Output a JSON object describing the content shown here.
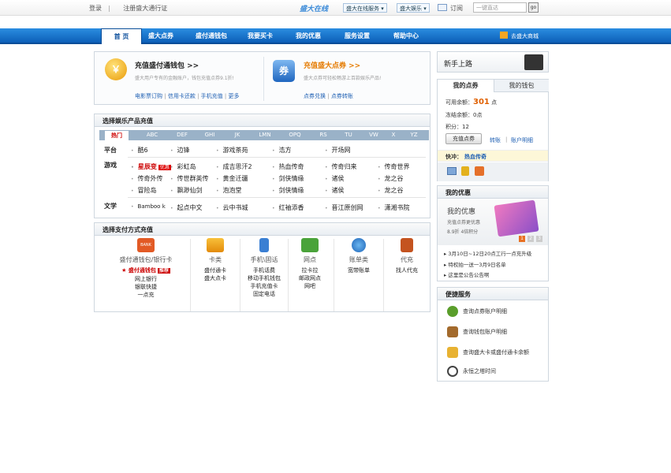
{
  "topbar": {
    "login": "登录",
    "register": "注册盛大通行证",
    "logo": "盛大在线",
    "services": "盛大在线服务 ▾",
    "ent": "盛大娱乐 ▾",
    "subscribe": "订阅",
    "search_placeholder": "一键直达",
    "go": "go"
  },
  "nav": {
    "items": [
      "首 页",
      "盛大点券",
      "盛付通钱包",
      "我要买卡",
      "我的优惠",
      "服务设置",
      "帮助中心"
    ],
    "mall": "去盛大商城"
  },
  "wallet": {
    "icon": "￥",
    "title": "充值盛付通钱包 >>",
    "desc": "盛大用户专有的金融账户，钱包充值点券9.1折!",
    "links": [
      "电影票订购",
      "信用卡还款",
      "手机充值",
      "更多"
    ]
  },
  "coupon": {
    "icon": "券",
    "title": "充值盛大点券 >>",
    "desc": "盛大点券可轻松畅游上百款娱乐产品!",
    "links": [
      "点券兑换",
      "点券转账"
    ]
  },
  "ent": {
    "title": "选择娱乐产品充值",
    "tabs": [
      "热门",
      "ABC",
      "DEF",
      "GHI",
      "JK",
      "LMN",
      "OPQ",
      "RS",
      "TU",
      "VW",
      "X",
      "YZ"
    ],
    "platform_label": "平台",
    "platform": [
      "酷6",
      "边锋",
      "游戏茶苑",
      "浩方",
      "开场网"
    ],
    "game_label": "游戏",
    "hot": "星辰变",
    "hot_badge": "优惠",
    "games": [
      "彩虹岛",
      "成吉思汗2",
      "热血传奇",
      "传奇归来",
      "传奇世界",
      "传奇外传",
      "传世群英传",
      "黄金迁疆",
      "剑侠情缘",
      "诸侯",
      "龙之谷",
      "冒险岛",
      "飘渺仙剑",
      "泡泡堂",
      "剑侠情缘",
      "诸侯",
      "龙之谷"
    ],
    "lit_label": "文学",
    "lit": [
      "Bamboo k",
      "起点中文",
      "云中书城",
      "红袖添香",
      "晋江原创网",
      "潇湘书院"
    ]
  },
  "pay": {
    "title": "选择支付方式充值",
    "cols": [
      {
        "title": "盛付通钱包/银行卡",
        "items": [
          "★ 盛付通钱包",
          "网上银行",
          "银联快捷",
          "一点充"
        ],
        "badge": "推荐"
      },
      {
        "title": "卡类",
        "items": [
          "盛付通卡",
          "盛大点卡"
        ]
      },
      {
        "title": "手机\\固话",
        "items": [
          "手机话费",
          "移动手机钱包",
          "手机充值卡",
          "固定电话"
        ]
      },
      {
        "title": "网点",
        "items": [
          "拉卡拉",
          "邮政网点",
          "网吧"
        ]
      },
      {
        "title": "账单类",
        "items": [
          "宽带账单"
        ]
      },
      {
        "title": "代充",
        "items": [
          "找人代充"
        ]
      }
    ]
  },
  "side": {
    "newbie": "新手上路",
    "tab_coupon": "我的点券",
    "tab_wallet": "我的钱包",
    "avail_label": "可用余额：",
    "avail_value": "301",
    "avail_unit": "点",
    "frozen": "冻结余额：0点",
    "points": "积分：12",
    "recharge": "充值点券",
    "transfer": "转账",
    "detail": "账户明细",
    "quick_label": "快冲：",
    "quick_game": "热血传奇",
    "promo_title": "我的优惠",
    "promo_head": "我的优惠",
    "promo_desc": "充值点券更优惠",
    "promo_desc2": "8.9折  4倍积分",
    "pages": [
      "1",
      "2",
      "3"
    ],
    "news": [
      "3月10日~12日20点工行一点充升级",
      "特权拍一送一3月9日名单",
      "这里是公告公告啊"
    ],
    "svc_title": "便捷服务",
    "services": [
      "查询点券账户明细",
      "查询钱包账户明细",
      "查询盛大卡或盛付通卡余额",
      "永恒之塔时间"
    ]
  }
}
